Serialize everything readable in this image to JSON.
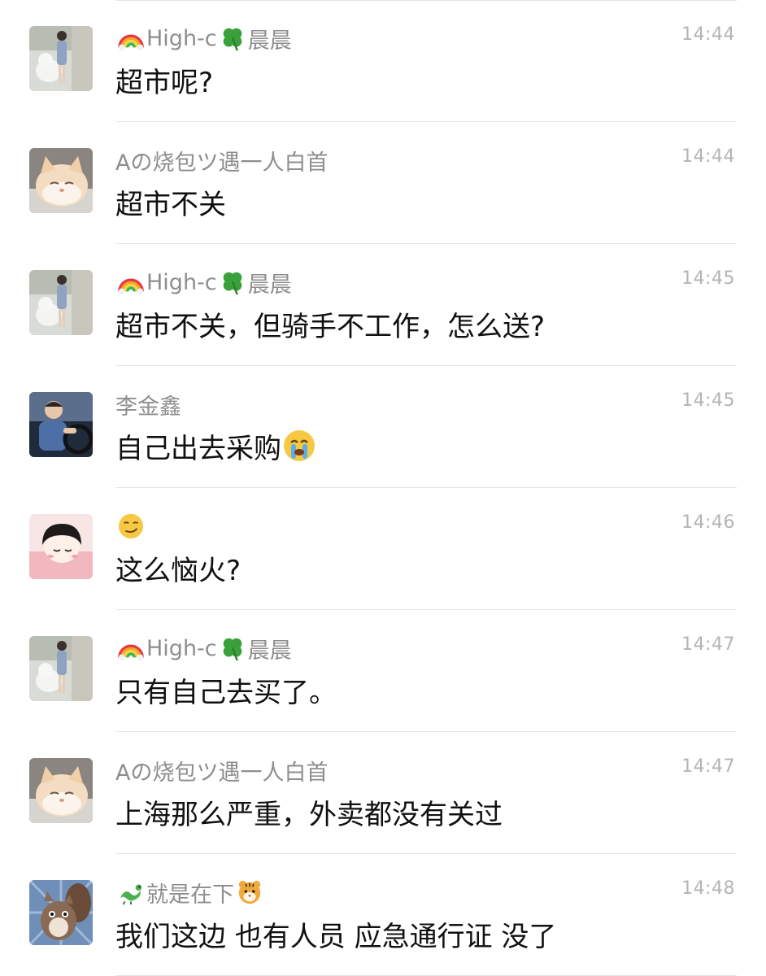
{
  "messages": [
    {
      "avatar": "avatar-girl-dog",
      "name_prefix_icon": "rainbow-icon",
      "name_part1": "High-c",
      "name_mid_icon": "four-leaf-clover-icon",
      "name_part2": "晨晨",
      "time": "14:44",
      "text": "超市呢?"
    },
    {
      "avatar": "avatar-cat",
      "name": "Aの烧包ツ遇一人白首",
      "time": "14:44",
      "text": "超市不关"
    },
    {
      "avatar": "avatar-girl-dog",
      "name_prefix_icon": "rainbow-icon",
      "name_part1": "High-c",
      "name_mid_icon": "four-leaf-clover-icon",
      "name_part2": "晨晨",
      "time": "14:45",
      "text": "超市不关，但骑手不工作，怎么送?"
    },
    {
      "avatar": "avatar-man-driving",
      "name": "李金鑫",
      "time": "14:45",
      "text": "自己出去采购",
      "text_suffix_icon": "crying-face-icon"
    },
    {
      "avatar": "avatar-cartoon-girl",
      "name_icon": "smirking-face-icon",
      "time": "14:46",
      "text": "这么恼火?"
    },
    {
      "avatar": "avatar-girl-dog",
      "name_prefix_icon": "rainbow-icon",
      "name_part1": "High-c",
      "name_mid_icon": "four-leaf-clover-icon",
      "name_part2": "晨晨",
      "time": "14:47",
      "text": "只有自己去买了。"
    },
    {
      "avatar": "avatar-cat",
      "name": "Aの烧包ツ遇一人白首",
      "time": "14:47",
      "text": "上海那么严重，外卖都没有关过"
    },
    {
      "avatar": "avatar-squirrel",
      "name_prefix_icon": "dragon-icon",
      "name_part1": "就是在下",
      "name_suffix_icon": "tiger-face-icon",
      "time": "14:48",
      "text": "我们这边 也有人员 应急通行证 没了"
    }
  ]
}
